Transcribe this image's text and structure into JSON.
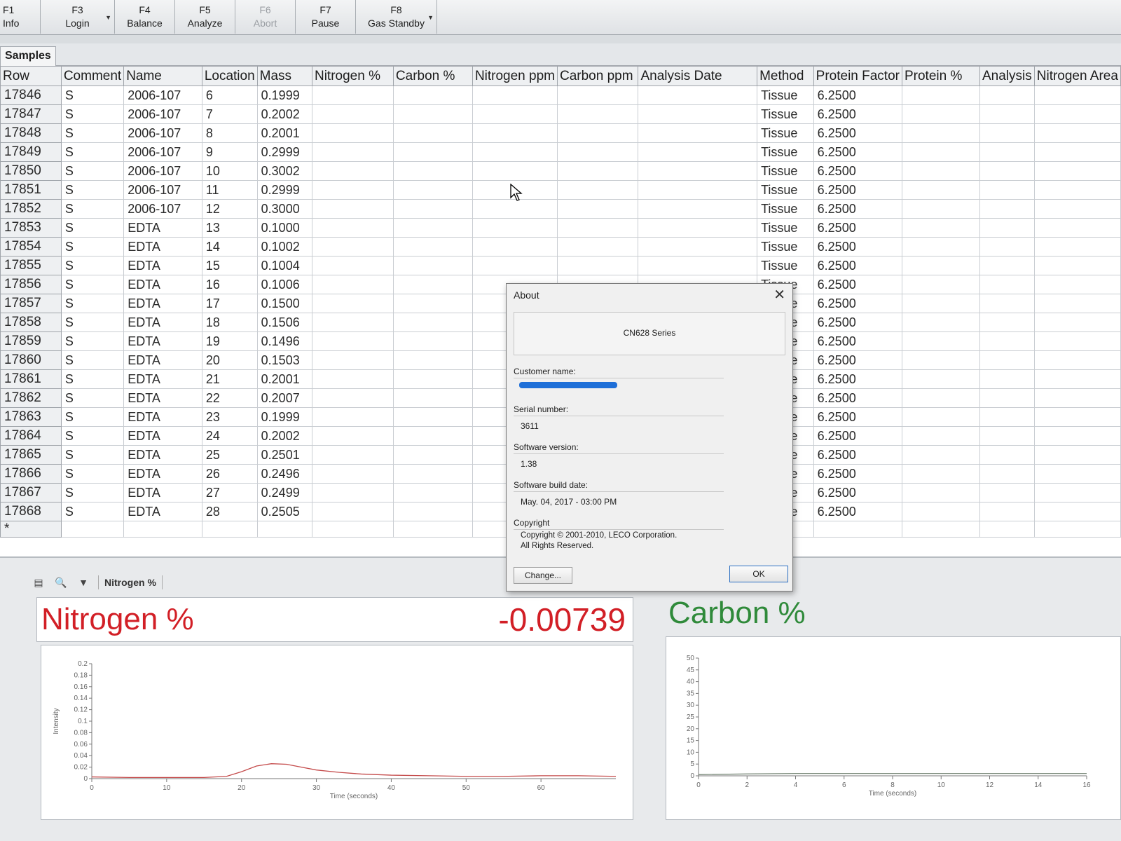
{
  "toolbar": {
    "keys": [
      {
        "key": "F1",
        "label": "Info"
      },
      {
        "key": "F3",
        "label": "Login"
      },
      {
        "key": "F4",
        "label": "Balance"
      },
      {
        "key": "F5",
        "label": "Analyze"
      },
      {
        "key": "F6",
        "label": "Abort"
      },
      {
        "key": "F7",
        "label": "Pause"
      },
      {
        "key": "F8",
        "label": "Gas Standby"
      }
    ]
  },
  "tabs": {
    "samples": "Samples"
  },
  "grid": {
    "columns": [
      "Row",
      "Comment",
      "Name",
      "Location",
      "Mass",
      "Nitrogen %",
      "Carbon %",
      "Nitrogen ppm",
      "Carbon ppm",
      "Analysis Date",
      "Method",
      "Protein Factor",
      "Protein %",
      "Analysis",
      "Nitrogen Area"
    ],
    "new_row_marker": "*",
    "rows": [
      {
        "row": "17846",
        "comment": "S",
        "name": "2006-107",
        "location": "6",
        "mass": "0.1999",
        "method": "Tissue",
        "protein_factor": "6.2500"
      },
      {
        "row": "17847",
        "comment": "S",
        "name": "2006-107",
        "location": "7",
        "mass": "0.2002",
        "method": "Tissue",
        "protein_factor": "6.2500"
      },
      {
        "row": "17848",
        "comment": "S",
        "name": "2006-107",
        "location": "8",
        "mass": "0.2001",
        "method": "Tissue",
        "protein_factor": "6.2500"
      },
      {
        "row": "17849",
        "comment": "S",
        "name": "2006-107",
        "location": "9",
        "mass": "0.2999",
        "method": "Tissue",
        "protein_factor": "6.2500"
      },
      {
        "row": "17850",
        "comment": "S",
        "name": "2006-107",
        "location": "10",
        "mass": "0.3002",
        "method": "Tissue",
        "protein_factor": "6.2500"
      },
      {
        "row": "17851",
        "comment": "S",
        "name": "2006-107",
        "location": "11",
        "mass": "0.2999",
        "method": "Tissue",
        "protein_factor": "6.2500"
      },
      {
        "row": "17852",
        "comment": "S",
        "name": "2006-107",
        "location": "12",
        "mass": "0.3000",
        "method": "Tissue",
        "protein_factor": "6.2500"
      },
      {
        "row": "17853",
        "comment": "S",
        "name": "EDTA",
        "location": "13",
        "mass": "0.1000",
        "method": "Tissue",
        "protein_factor": "6.2500"
      },
      {
        "row": "17854",
        "comment": "S",
        "name": "EDTA",
        "location": "14",
        "mass": "0.1002",
        "method": "Tissue",
        "protein_factor": "6.2500"
      },
      {
        "row": "17855",
        "comment": "S",
        "name": "EDTA",
        "location": "15",
        "mass": "0.1004",
        "method": "Tissue",
        "protein_factor": "6.2500"
      },
      {
        "row": "17856",
        "comment": "S",
        "name": "EDTA",
        "location": "16",
        "mass": "0.1006",
        "method": "Tissue",
        "protein_factor": "6.2500"
      },
      {
        "row": "17857",
        "comment": "S",
        "name": "EDTA",
        "location": "17",
        "mass": "0.1500",
        "method": "Tissue",
        "protein_factor": "6.2500"
      },
      {
        "row": "17858",
        "comment": "S",
        "name": "EDTA",
        "location": "18",
        "mass": "0.1506",
        "method": "Tissue",
        "protein_factor": "6.2500"
      },
      {
        "row": "17859",
        "comment": "S",
        "name": "EDTA",
        "location": "19",
        "mass": "0.1496",
        "method": "Tissue",
        "protein_factor": "6.2500"
      },
      {
        "row": "17860",
        "comment": "S",
        "name": "EDTA",
        "location": "20",
        "mass": "0.1503",
        "method": "Tissue",
        "protein_factor": "6.2500"
      },
      {
        "row": "17861",
        "comment": "S",
        "name": "EDTA",
        "location": "21",
        "mass": "0.2001",
        "method": "Tissue",
        "protein_factor": "6.2500"
      },
      {
        "row": "17862",
        "comment": "S",
        "name": "EDTA",
        "location": "22",
        "mass": "0.2007",
        "method": "Tissue",
        "protein_factor": "6.2500"
      },
      {
        "row": "17863",
        "comment": "S",
        "name": "EDTA",
        "location": "23",
        "mass": "0.1999",
        "method": "Tissue",
        "protein_factor": "6.2500"
      },
      {
        "row": "17864",
        "comment": "S",
        "name": "EDTA",
        "location": "24",
        "mass": "0.2002",
        "method": "Tissue",
        "protein_factor": "6.2500"
      },
      {
        "row": "17865",
        "comment": "S",
        "name": "EDTA",
        "location": "25",
        "mass": "0.2501",
        "method": "Tissue",
        "protein_factor": "6.2500"
      },
      {
        "row": "17866",
        "comment": "S",
        "name": "EDTA",
        "location": "26",
        "mass": "0.2496",
        "method": "Tissue",
        "protein_factor": "6.2500"
      },
      {
        "row": "17867",
        "comment": "S",
        "name": "EDTA",
        "location": "27",
        "mass": "0.2499",
        "method": "Tissue",
        "protein_factor": "6.2500"
      },
      {
        "row": "17868",
        "comment": "S",
        "name": "EDTA",
        "location": "28",
        "mass": "0.2505",
        "method": "Tissue",
        "protein_factor": "6.2500"
      }
    ]
  },
  "lower_toolbar": {
    "selector_label": "Nitrogen %"
  },
  "nitrogen_panel": {
    "title": "Nitrogen %",
    "value": "-0.00739",
    "color": "#d21f26"
  },
  "carbon_panel": {
    "title": "Carbon %",
    "color": "#2f8a3a"
  },
  "about_dialog": {
    "title": "About",
    "product": "CN628 Series",
    "customer_name_label": "Customer name:",
    "serial_label": "Serial number:",
    "serial_value": "3611",
    "version_label": "Software version:",
    "version_value": "1.38",
    "build_date_label": "Software build date:",
    "build_date_value": "May. 04, 2017 - 03:00 PM",
    "copyright_label": "Copyright",
    "copyright_line1": "Copyright © 2001-2010, LECO Corporation.",
    "copyright_line2": "All Rights Reserved.",
    "change_button": "Change...",
    "ok_button": "OK"
  },
  "chart_data": [
    {
      "type": "line",
      "title": "",
      "xlabel": "Time (seconds)",
      "ylabel": "Intensity",
      "xlim": [
        0,
        70
      ],
      "ylim": [
        0,
        0.2
      ],
      "x_ticks": [
        "0",
        "10",
        "20",
        "30",
        "40",
        "50",
        "60"
      ],
      "y_ticks": [
        "0",
        "0.02",
        "0.04",
        "0.06",
        "0.08",
        "0.1",
        "0.12",
        "0.14",
        "0.16",
        "0.18",
        "0.2"
      ],
      "series": [
        {
          "color": "#c44a4a",
          "x": [
            0,
            5,
            10,
            15,
            18,
            20,
            22,
            24,
            26,
            28,
            30,
            33,
            36,
            40,
            45,
            50,
            55,
            60,
            65,
            70
          ],
          "y": [
            0.003,
            0.002,
            0.002,
            0.002,
            0.004,
            0.012,
            0.022,
            0.026,
            0.025,
            0.02,
            0.015,
            0.011,
            0.008,
            0.006,
            0.005,
            0.004,
            0.004,
            0.005,
            0.005,
            0.004
          ]
        }
      ]
    },
    {
      "type": "line",
      "title": "",
      "xlabel": "Time (seconds)",
      "ylabel": "Intensity",
      "xlim": [
        0,
        16
      ],
      "ylim": [
        0,
        50
      ],
      "x_ticks": [
        "0",
        "2",
        "4",
        "6",
        "8",
        "10",
        "12",
        "14",
        "16"
      ],
      "y_ticks": [
        "0",
        "5",
        "10",
        "15",
        "20",
        "25",
        "30",
        "35",
        "40",
        "45",
        "50"
      ],
      "series": [
        {
          "color": "#7a8a7a",
          "x": [
            0,
            2,
            4,
            6,
            8,
            10,
            12,
            14,
            16
          ],
          "y": [
            0.5,
            0.8,
            1,
            1,
            1,
            1,
            1,
            1,
            1
          ]
        }
      ]
    }
  ]
}
